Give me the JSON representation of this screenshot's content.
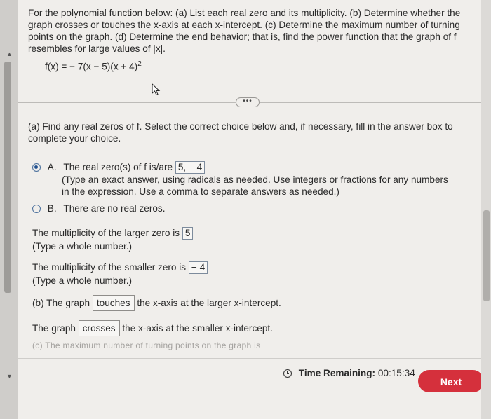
{
  "question": {
    "text": "For the polynomial function below: (a) List each real zero and its multiplicity. (b) Determine whether the graph crosses or touches the x-axis at each x-intercept. (c) Determine the maximum number of turning points on the graph. (d) Determine the end behavior; that is, find the power function that the graph of f resembles for large values of |x|.",
    "equation_main": "f(x) = − 7(x − 5)(x + 4)",
    "equation_exp": "2"
  },
  "part_a": {
    "prompt": "(a) Find any real zeros of f. Select the correct choice below and, if necessary, fill in the answer box to complete your choice.",
    "option_a_letter": "A.",
    "option_a_text": "The real zero(s) of f is/are",
    "option_a_value": "5, − 4",
    "option_a_hint": "(Type an exact answer, using radicals as needed. Use integers or fractions for any numbers in the expression. Use a comma to separate answers as needed.)",
    "option_b_letter": "B.",
    "option_b_text": "There are no real zeros.",
    "mult_larger_text": "The multiplicity of the larger zero is",
    "mult_larger_value": "5",
    "mult_larger_hint": "(Type a whole number.)",
    "mult_smaller_text": "The multiplicity of the smaller zero is",
    "mult_smaller_value": "− 4",
    "mult_smaller_hint": "(Type a whole number.)"
  },
  "part_b": {
    "prefix": "(b) The graph",
    "larger_choice": "touches",
    "larger_suffix": "the x-axis at the larger x-intercept.",
    "prefix2": "The graph",
    "smaller_choice": "crosses",
    "smaller_suffix": "the x-axis at the smaller x-intercept."
  },
  "part_c_faded": "(c) The maximum number of turning points on the graph is",
  "footer": {
    "time_label": "Time Remaining:",
    "time_value": "00:15:34",
    "next_label": "Next"
  },
  "colors": {
    "next": "#d5303c",
    "radio": "#1f4f8f"
  }
}
